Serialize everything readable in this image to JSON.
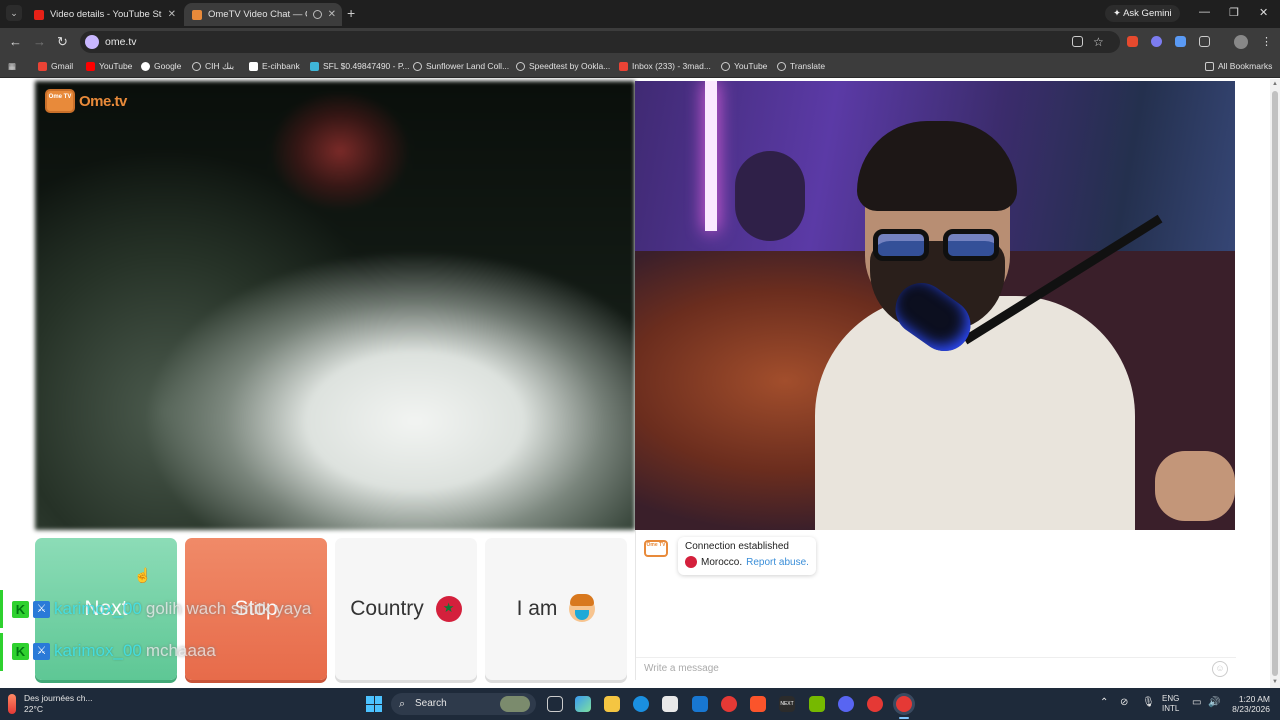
{
  "browser": {
    "tabs": [
      {
        "title": "Video details - YouTube Studio",
        "favicon": "youtube-studio-icon",
        "color": "#e62117"
      },
      {
        "title": "OmeTV Video Chat — Ome",
        "favicon": "ometv-icon",
        "color": "#e88a3a"
      }
    ],
    "ask_gemini": "Ask Gemini",
    "url": "ome.tv",
    "bookmarks": [
      {
        "label": "Gmail",
        "icon": "gmail-icon",
        "color": "#ea4335"
      },
      {
        "label": "YouTube",
        "icon": "youtube-icon",
        "color": "#ff0000"
      },
      {
        "label": "Google",
        "icon": "google-icon",
        "color": "#ffffff"
      },
      {
        "label": "CIH بنك",
        "icon": "globe-icon",
        "color": "#cccccc"
      },
      {
        "label": "E-cihbank",
        "icon": "ecihbank-icon",
        "color": "#ffffff"
      },
      {
        "label": "SFL $0.49847490 - P...",
        "icon": "sfl-icon",
        "color": "#3fb6d8"
      },
      {
        "label": "Sunflower Land Coll...",
        "icon": "globe-icon",
        "color": "#cccccc"
      },
      {
        "label": "Speedtest by Ookla...",
        "icon": "speedtest-icon",
        "color": "#cccccc"
      },
      {
        "label": "Inbox (233) - 3mad...",
        "icon": "gmail-icon",
        "color": "#ea4335"
      },
      {
        "label": "YouTube",
        "icon": "globe-icon",
        "color": "#cccccc"
      },
      {
        "label": "Translate",
        "icon": "globe-icon",
        "color": "#cccccc"
      }
    ],
    "all_bookmarks": "All Bookmarks"
  },
  "ometv": {
    "logo_text": "Ome.tv",
    "logo_box": "Ome TV",
    "buttons": {
      "next": "Next",
      "stop": "Stop",
      "country": "Country",
      "i_am": "I am"
    },
    "colors": {
      "next": "#5ec795",
      "stop": "#e76b4a",
      "brand": "#e88a3a",
      "morocco_red": "#d4203c"
    },
    "chat": {
      "status": "Connection established",
      "country": "Morocco.",
      "report": "Report abuse.",
      "input_placeholder": "Write a message"
    }
  },
  "stream_overlay": [
    {
      "user": "karimox_00",
      "message": "golih wach smitk yaya"
    },
    {
      "user": "karimox_00",
      "message": "mchaaaa"
    }
  ],
  "taskbar": {
    "weather_title": "Des journées ch...",
    "temperature": "22°C",
    "search": "Search",
    "lang_top": "ENG",
    "lang_bottom": "INTL",
    "time": "1:20 AM",
    "date": "8/23/2026"
  }
}
